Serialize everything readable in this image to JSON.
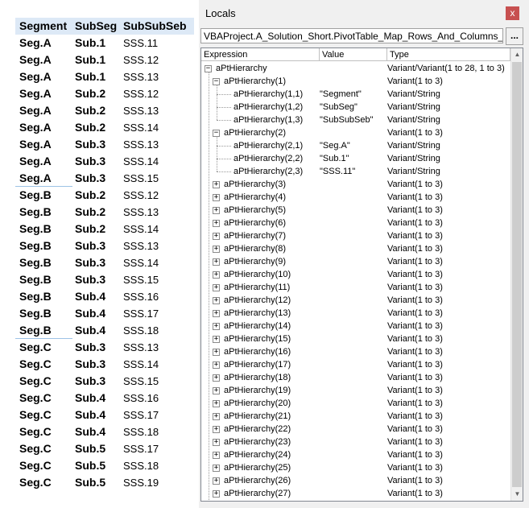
{
  "pivot": {
    "headers": [
      "Segment",
      "SubSeg",
      "SubSubSeb"
    ],
    "rows": [
      [
        "Seg.A",
        "Sub.1",
        "SSS.11"
      ],
      [
        "Seg.A",
        "Sub.1",
        "SSS.12"
      ],
      [
        "Seg.A",
        "Sub.1",
        "SSS.13"
      ],
      [
        "Seg.A",
        "Sub.2",
        "SSS.12"
      ],
      [
        "Seg.A",
        "Sub.2",
        "SSS.13"
      ],
      [
        "Seg.A",
        "Sub.2",
        "SSS.14"
      ],
      [
        "Seg.A",
        "Sub.3",
        "SSS.13"
      ],
      [
        "Seg.A",
        "Sub.3",
        "SSS.14"
      ],
      [
        "Seg.A",
        "Sub.3",
        "SSS.15"
      ],
      [
        "Seg.B",
        "Sub.2",
        "SSS.12"
      ],
      [
        "Seg.B",
        "Sub.2",
        "SSS.13"
      ],
      [
        "Seg.B",
        "Sub.2",
        "SSS.14"
      ],
      [
        "Seg.B",
        "Sub.3",
        "SSS.13"
      ],
      [
        "Seg.B",
        "Sub.3",
        "SSS.14"
      ],
      [
        "Seg.B",
        "Sub.3",
        "SSS.15"
      ],
      [
        "Seg.B",
        "Sub.4",
        "SSS.16"
      ],
      [
        "Seg.B",
        "Sub.4",
        "SSS.17"
      ],
      [
        "Seg.B",
        "Sub.4",
        "SSS.18"
      ],
      [
        "Seg.C",
        "Sub.3",
        "SSS.13"
      ],
      [
        "Seg.C",
        "Sub.3",
        "SSS.14"
      ],
      [
        "Seg.C",
        "Sub.3",
        "SSS.15"
      ],
      [
        "Seg.C",
        "Sub.4",
        "SSS.16"
      ],
      [
        "Seg.C",
        "Sub.4",
        "SSS.17"
      ],
      [
        "Seg.C",
        "Sub.4",
        "SSS.18"
      ],
      [
        "Seg.C",
        "Sub.5",
        "SSS.17"
      ],
      [
        "Seg.C",
        "Sub.5",
        "SSS.18"
      ],
      [
        "Seg.C",
        "Sub.5",
        "SSS.19"
      ]
    ]
  },
  "locals": {
    "title": "Locals",
    "close_label": "x",
    "context": "VBAProject.A_Solution_Short.PivotTable_Map_Rows_And_Columns_TEST",
    "ellipsis_label": "...",
    "columns": [
      "Expression",
      "Value",
      "Type"
    ],
    "scroll_up_icon": "▲",
    "scroll_down_icon": "▼",
    "tree": [
      {
        "level": 0,
        "toggle": "−",
        "expr": "aPtHierarchy",
        "value": "",
        "type": "Variant/Variant(1 to 28, 1 to 3)"
      },
      {
        "level": 1,
        "toggle": "−",
        "expr": "aPtHierarchy(1)",
        "value": "",
        "type": "Variant(1 to 3)"
      },
      {
        "level": 2,
        "toggle": "",
        "expr": "aPtHierarchy(1,1)",
        "value": "\"Segment\"",
        "type": "Variant/String"
      },
      {
        "level": 2,
        "toggle": "",
        "expr": "aPtHierarchy(1,2)",
        "value": "\"SubSeg\"",
        "type": "Variant/String"
      },
      {
        "level": 2,
        "toggle": "",
        "expr": "aPtHierarchy(1,3)",
        "value": "\"SubSubSeb\"",
        "type": "Variant/String"
      },
      {
        "level": 1,
        "toggle": "−",
        "expr": "aPtHierarchy(2)",
        "value": "",
        "type": "Variant(1 to 3)"
      },
      {
        "level": 2,
        "toggle": "",
        "expr": "aPtHierarchy(2,1)",
        "value": "\"Seg.A\"",
        "type": "Variant/String"
      },
      {
        "level": 2,
        "toggle": "",
        "expr": "aPtHierarchy(2,2)",
        "value": "\"Sub.1\"",
        "type": "Variant/String"
      },
      {
        "level": 2,
        "toggle": "",
        "expr": "aPtHierarchy(2,3)",
        "value": "\"SSS.11\"",
        "type": "Variant/String"
      },
      {
        "level": 1,
        "toggle": "+",
        "expr": "aPtHierarchy(3)",
        "value": "",
        "type": "Variant(1 to 3)"
      },
      {
        "level": 1,
        "toggle": "+",
        "expr": "aPtHierarchy(4)",
        "value": "",
        "type": "Variant(1 to 3)"
      },
      {
        "level": 1,
        "toggle": "+",
        "expr": "aPtHierarchy(5)",
        "value": "",
        "type": "Variant(1 to 3)"
      },
      {
        "level": 1,
        "toggle": "+",
        "expr": "aPtHierarchy(6)",
        "value": "",
        "type": "Variant(1 to 3)"
      },
      {
        "level": 1,
        "toggle": "+",
        "expr": "aPtHierarchy(7)",
        "value": "",
        "type": "Variant(1 to 3)"
      },
      {
        "level": 1,
        "toggle": "+",
        "expr": "aPtHierarchy(8)",
        "value": "",
        "type": "Variant(1 to 3)"
      },
      {
        "level": 1,
        "toggle": "+",
        "expr": "aPtHierarchy(9)",
        "value": "",
        "type": "Variant(1 to 3)"
      },
      {
        "level": 1,
        "toggle": "+",
        "expr": "aPtHierarchy(10)",
        "value": "",
        "type": "Variant(1 to 3)"
      },
      {
        "level": 1,
        "toggle": "+",
        "expr": "aPtHierarchy(11)",
        "value": "",
        "type": "Variant(1 to 3)"
      },
      {
        "level": 1,
        "toggle": "+",
        "expr": "aPtHierarchy(12)",
        "value": "",
        "type": "Variant(1 to 3)"
      },
      {
        "level": 1,
        "toggle": "+",
        "expr": "aPtHierarchy(13)",
        "value": "",
        "type": "Variant(1 to 3)"
      },
      {
        "level": 1,
        "toggle": "+",
        "expr": "aPtHierarchy(14)",
        "value": "",
        "type": "Variant(1 to 3)"
      },
      {
        "level": 1,
        "toggle": "+",
        "expr": "aPtHierarchy(15)",
        "value": "",
        "type": "Variant(1 to 3)"
      },
      {
        "level": 1,
        "toggle": "+",
        "expr": "aPtHierarchy(16)",
        "value": "",
        "type": "Variant(1 to 3)"
      },
      {
        "level": 1,
        "toggle": "+",
        "expr": "aPtHierarchy(17)",
        "value": "",
        "type": "Variant(1 to 3)"
      },
      {
        "level": 1,
        "toggle": "+",
        "expr": "aPtHierarchy(18)",
        "value": "",
        "type": "Variant(1 to 3)"
      },
      {
        "level": 1,
        "toggle": "+",
        "expr": "aPtHierarchy(19)",
        "value": "",
        "type": "Variant(1 to 3)"
      },
      {
        "level": 1,
        "toggle": "+",
        "expr": "aPtHierarchy(20)",
        "value": "",
        "type": "Variant(1 to 3)"
      },
      {
        "level": 1,
        "toggle": "+",
        "expr": "aPtHierarchy(21)",
        "value": "",
        "type": "Variant(1 to 3)"
      },
      {
        "level": 1,
        "toggle": "+",
        "expr": "aPtHierarchy(22)",
        "value": "",
        "type": "Variant(1 to 3)"
      },
      {
        "level": 1,
        "toggle": "+",
        "expr": "aPtHierarchy(23)",
        "value": "",
        "type": "Variant(1 to 3)"
      },
      {
        "level": 1,
        "toggle": "+",
        "expr": "aPtHierarchy(24)",
        "value": "",
        "type": "Variant(1 to 3)"
      },
      {
        "level": 1,
        "toggle": "+",
        "expr": "aPtHierarchy(25)",
        "value": "",
        "type": "Variant(1 to 3)"
      },
      {
        "level": 1,
        "toggle": "+",
        "expr": "aPtHierarchy(26)",
        "value": "",
        "type": "Variant(1 to 3)"
      },
      {
        "level": 1,
        "toggle": "+",
        "expr": "aPtHierarchy(27)",
        "value": "",
        "type": "Variant(1 to 3)"
      }
    ]
  }
}
